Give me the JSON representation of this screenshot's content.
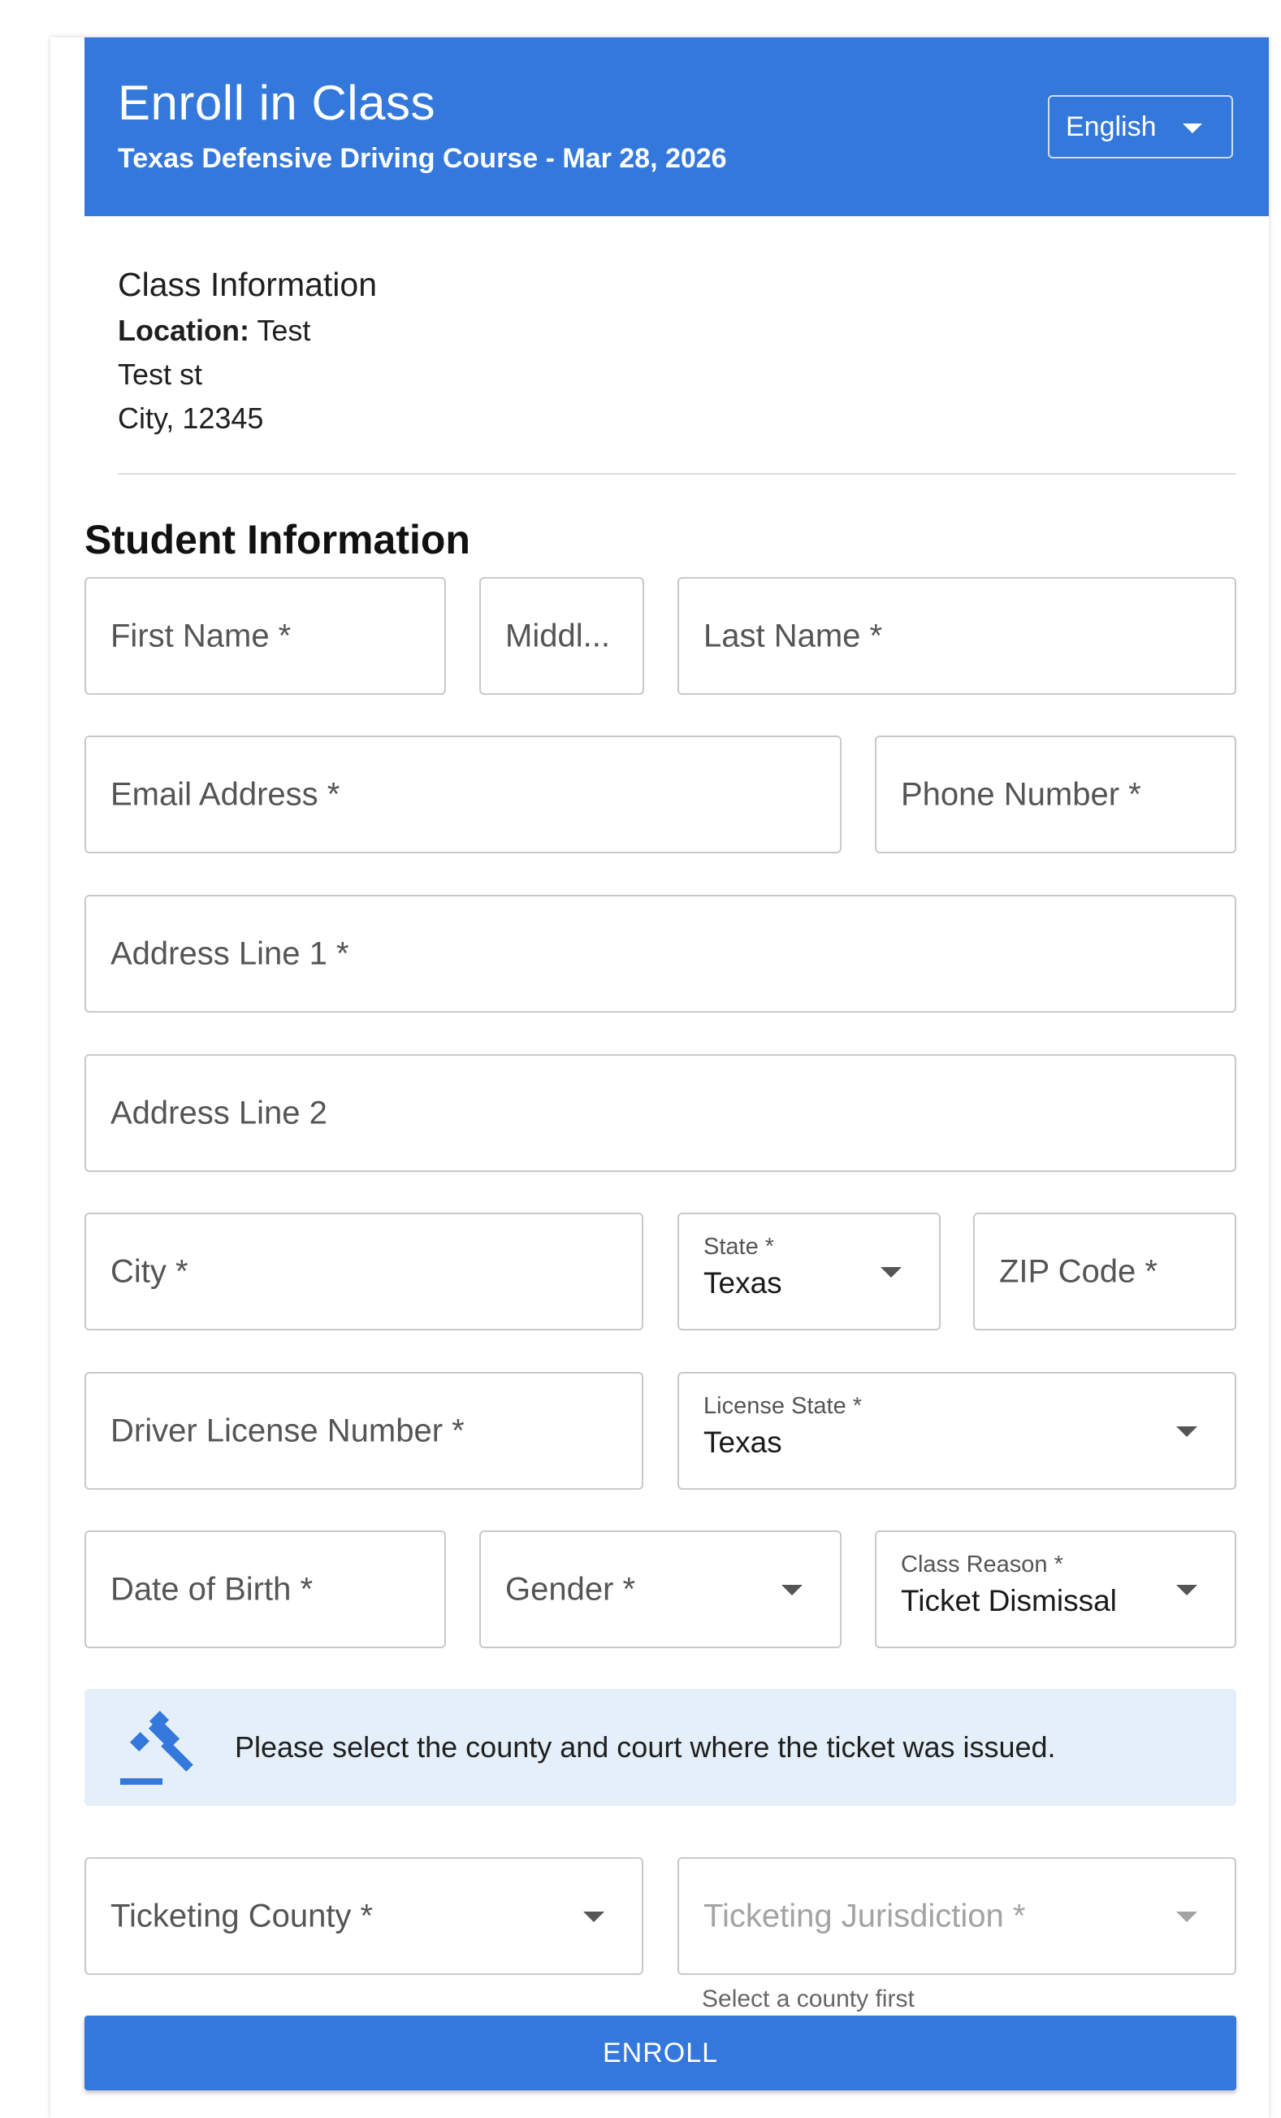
{
  "header": {
    "title": "Enroll in Class",
    "subtitle": "Texas Defensive Driving Course - Mar 28, 2026",
    "language": "English"
  },
  "class_info": {
    "title": "Class Information",
    "location_label": "Location:",
    "location_name": "Test",
    "street": "Test st",
    "city_zip": "City, 12345"
  },
  "student": {
    "section_title": "Student Information",
    "first_name": "First Name *",
    "middle_name": "Middl...",
    "last_name": "Last Name *",
    "email": "Email Address *",
    "phone": "Phone Number *",
    "address1": "Address Line 1 *",
    "address2": "Address Line 2",
    "city": "City *",
    "state_label": "State *",
    "state_value": "Texas",
    "zip": "ZIP Code *",
    "license_number": "Driver License Number *",
    "license_state_label": "License State *",
    "license_state_value": "Texas",
    "dob": "Date of Birth *",
    "gender": "Gender *",
    "class_reason_label": "Class Reason *",
    "class_reason_value": "Ticket Dismissal"
  },
  "alert": {
    "icon": "gavel-icon",
    "message": "Please select the county and court where the ticket was issued."
  },
  "ticket": {
    "county": "Ticketing County *",
    "jurisdiction": "Ticketing Jurisdiction *",
    "jurisdiction_helper": "Select a county first"
  },
  "actions": {
    "enroll": "ENROLL"
  },
  "colors": {
    "primary": "#3578dc",
    "alert_bg": "#e4eff9"
  }
}
